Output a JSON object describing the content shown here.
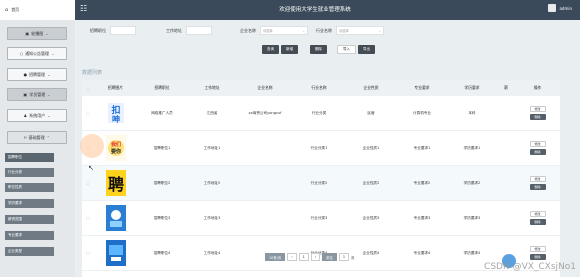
{
  "header": {
    "home_label": "首页",
    "system_title": "欢迎使用大学生就业管理系统",
    "admin_name": "admin"
  },
  "sidebar": {
    "items": [
      {
        "label": "轮播图"
      },
      {
        "label": "通知公告管理"
      },
      {
        "label": "招聘管理"
      },
      {
        "label": "学员管理"
      },
      {
        "label": "系统用户"
      },
      {
        "label": "基础管理"
      }
    ],
    "submenu": [
      "招聘职位",
      "行业分类",
      "职位性质",
      "学历要求",
      "薪资范围",
      "专业要求",
      "企业类型"
    ]
  },
  "filters": {
    "label_1": "招聘职位",
    "label_2": "工作地址",
    "label_3": "企业名称",
    "label_4": "行业名称",
    "select_1": "请选择",
    "select_2": "请选择"
  },
  "buttons": {
    "query": "查询",
    "add": "新增",
    "batch_delete": "删除",
    "import": "导入",
    "export": "导出"
  },
  "section_title": "数据列表",
  "table": {
    "headers": [
      "招聘图片",
      "招聘职位",
      "工作地址",
      "企业名称",
      "行业名称",
      "企业性质",
      "专业要求",
      "学历要求",
      "薪",
      "操作"
    ],
    "rows": [
      {
        "position": "网络推广人员",
        "address": "江西省",
        "company": "xx商贸公司yongcuf",
        "industry": "行业分类",
        "nature": "民营",
        "major": "计算机专业",
        "education": "本科"
      },
      {
        "position": "招聘职位1",
        "address": "工作地址1",
        "company": "",
        "industry": "行业分类1",
        "nature": "企业性质1",
        "major": "专业要求1",
        "education": "学历要求1"
      },
      {
        "position": "招聘职位2",
        "address": "工作地址2",
        "company": "",
        "industry": "行业分类2",
        "nature": "企业性质2",
        "major": "专业要求2",
        "education": "学历要求2"
      },
      {
        "position": "招聘职位3",
        "address": "工作地址3",
        "company": "",
        "industry": "行业分类3",
        "nature": "企业性质3",
        "major": "专业要求3",
        "education": "学历要求3"
      },
      {
        "position": "招聘职位4",
        "address": "工作地址4",
        "company": "",
        "industry": "行业分类4",
        "nature": "企业性质4",
        "major": "专业要求4",
        "education": "学历要求4"
      }
    ],
    "edit_label": "修改",
    "delete_label": "删除"
  },
  "pagination": {
    "page_size": "10条/页",
    "prev": "‹",
    "current_page": "1",
    "next": "›",
    "goto_label": "前往",
    "goto_page": "1",
    "unit": "页"
  },
  "watermark": "CSDN @VX_CXsjNo1",
  "colors": {
    "topbar": "#3a4a5a",
    "sidebar_sub": "#6f7a84",
    "button_dark": "#444c54",
    "fab": "#5aa0e0"
  },
  "icons": [
    "home-icon",
    "menu-toggle-icon",
    "user-avatar-icon",
    "image-icon",
    "bell-icon",
    "briefcase-icon",
    "users-icon",
    "user-icon",
    "grid-icon",
    "chevron-down-icon",
    "chevron-up-icon"
  ]
}
